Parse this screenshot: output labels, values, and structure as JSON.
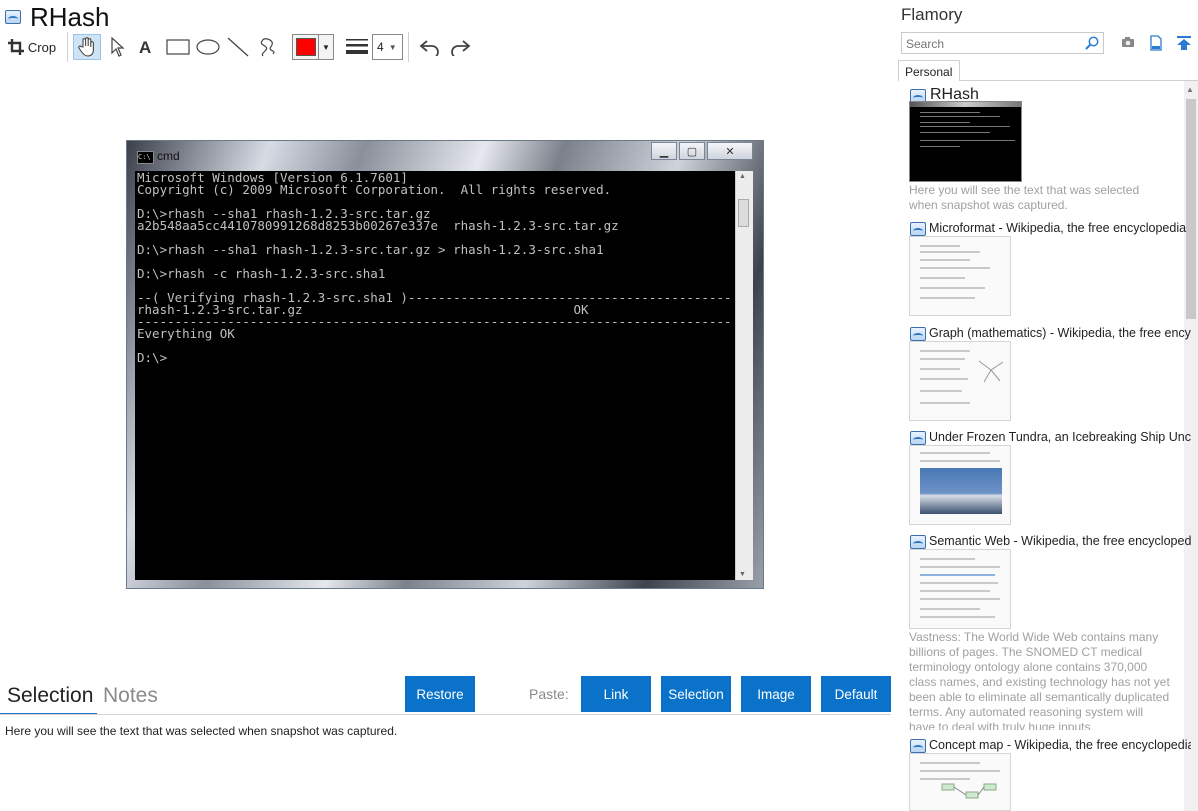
{
  "app": {
    "title": "RHash"
  },
  "toolbar": {
    "crop_label": "Crop",
    "line_width": "4",
    "color": "#ff0000"
  },
  "screenshot": {
    "window_title": "cmd",
    "console_lines": [
      "Microsoft Windows [Version 6.1.7601]",
      "Copyright (c) 2009 Microsoft Corporation.  All rights reserved.",
      "",
      "D:\\>rhash --sha1 rhash-1.2.3-src.tar.gz",
      "a2b548aa5cc4410780991268d8253b00267e337e  rhash-1.2.3-src.tar.gz",
      "",
      "D:\\>rhash --sha1 rhash-1.2.3-src.tar.gz > rhash-1.2.3-src.sha1",
      "",
      "D:\\>rhash -c rhash-1.2.3-src.sha1",
      "",
      "--( Verifying rhash-1.2.3-src.sha1 )-------------------------------------------",
      "rhash-1.2.3-src.tar.gz                                    OK",
      "-------------------------------------------------------------------------------",
      "Everything OK",
      "",
      "D:\\>"
    ]
  },
  "bottom": {
    "tabs": [
      "Selection",
      "Notes"
    ],
    "restore_label": "Restore",
    "paste_label": "Paste:",
    "paste_buttons": [
      "Link",
      "Selection",
      "Image",
      "Default"
    ],
    "selection_text": "Here you will see the text that was selected when snapshot was captured."
  },
  "panel": {
    "title": "Flamory",
    "search_placeholder": "Search",
    "tab": "Personal",
    "items": [
      {
        "title": "RHash",
        "desc": "Here you will see the text that was selected when snapshot was captured."
      },
      {
        "title": "Microformat - Wikipedia, the free encyclopedia"
      },
      {
        "title": "Graph (mathematics) - Wikipedia, the free ency"
      },
      {
        "title": "Under Frozen Tundra, an Icebreaking Ship Unco"
      },
      {
        "title": "Semantic Web - Wikipedia, the free encycloped",
        "desc": "Vastness: The World Wide Web contains many billions of pages. The SNOMED CT medical terminology ontology alone contains 370,000 class names, and existing technology has not yet been able to eliminate all semantically duplicated terms. Any automated reasoning system will have to deal with truly huge inputs."
      },
      {
        "title": "Concept map - Wikipedia, the free encyclopedia"
      }
    ]
  }
}
